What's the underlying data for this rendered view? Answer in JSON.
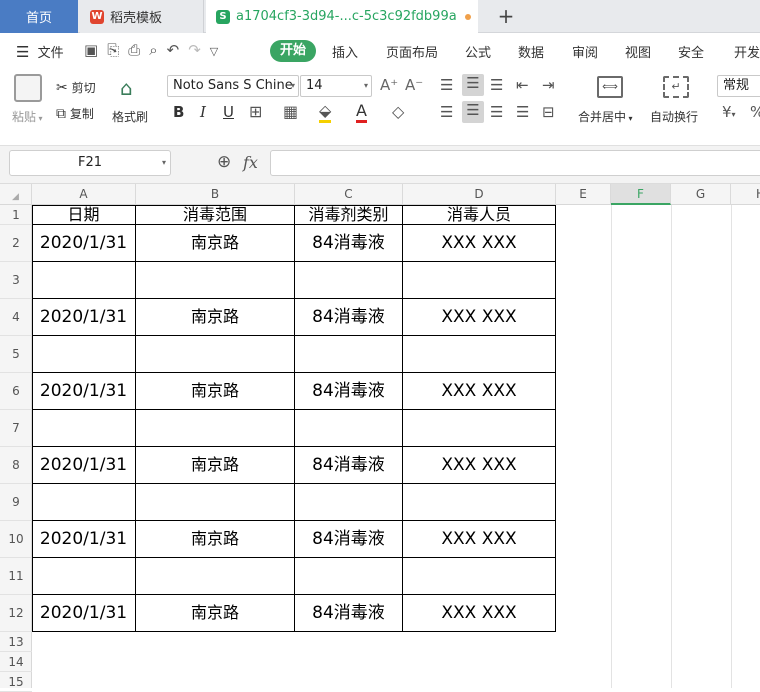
{
  "tabs": {
    "home": "首页",
    "wps": "稻壳模板",
    "doc": "a1704cf3-3d94-...c-5c3c92fdb99a",
    "add": "+"
  },
  "menu": {
    "file": "文件",
    "items": [
      "开始",
      "插入",
      "页面布局",
      "公式",
      "数据",
      "审阅",
      "视图",
      "安全",
      "开发"
    ]
  },
  "ribbon": {
    "paste": "粘贴",
    "cut": "剪切",
    "copy": "复制",
    "format_painter": "格式刷",
    "font_name": "Noto Sans S Chine",
    "font_size": "14",
    "merge_center": "合并居中",
    "wrap_text": "自动换行",
    "number_format": "常规"
  },
  "formula_bar": {
    "cell_ref": "F21",
    "fx": "fx",
    "value": ""
  },
  "columns": [
    "A",
    "B",
    "C",
    "D",
    "E",
    "F",
    "G",
    "H"
  ],
  "rows": [
    "1",
    "2",
    "3",
    "4",
    "5",
    "6",
    "7",
    "8",
    "9",
    "10",
    "11",
    "12",
    "13",
    "14",
    "15"
  ],
  "table": {
    "headers": [
      "日期",
      "消毒范围",
      "消毒剂类别",
      "消毒人员"
    ],
    "data_row": [
      "2020/1/31",
      "南京路",
      "84消毒液",
      "XXX XXX"
    ]
  },
  "colors": {
    "accent": "#3aa563",
    "home_tab": "#4a7cc4",
    "selected_col": "#3aa563"
  }
}
